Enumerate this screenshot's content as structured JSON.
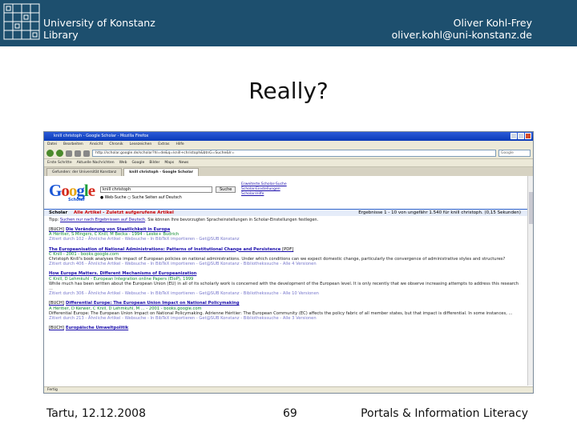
{
  "header": {
    "university_line1": "University of Konstanz",
    "university_line2": "Library",
    "author_name": "Oliver Kohl-Frey",
    "author_email": "oliver.kohl@uni-konstanz.de",
    "colors": {
      "band": "#1d4f6e",
      "text": "#ffffff"
    }
  },
  "slide": {
    "title": "Really?"
  },
  "browser": {
    "window_title": "knill christoph - Google Scholar - Mozilla Firefox",
    "menu": [
      "Datei",
      "Bearbeiten",
      "Ansicht",
      "Chronik",
      "Lesezeichen",
      "Extras",
      "Hilfe"
    ],
    "url": "http://scholar.google.de/scholar?hl=de&q=knill+christoph&btnG=Suche&lr=",
    "search_placeholder": "Google",
    "bookmarks": [
      "Erste Schritte",
      "Aktuelle Nachrichten",
      "Web",
      "Google",
      "Bilder",
      "Maps",
      "News"
    ],
    "tabs": [
      {
        "label": "Gefunden: der Universität Konstanz",
        "active": false
      },
      {
        "label": "knill christoph - Google Scholar",
        "active": true
      }
    ],
    "scholar": {
      "logo_sub": "Scholar",
      "query": "knill christoph",
      "search_button": "Suche",
      "options": "● Web-Suche  ○ Suche Seiten auf Deutsch",
      "links": [
        "Erweiterte Scholar-Suche",
        "Scholar-Einstellungen",
        "Scholar-Hilfe"
      ],
      "result_bar_label": "Scholar",
      "result_bar_filter": "Alle Artikel - Zuletzt aufgerufene Artikel",
      "result_count": "Ergebnisse 1 - 10 von ungefähr 1.540 für knill christoph. (0,15 Sekunden)",
      "tip_prefix": "Tipp:",
      "tip_link": "Suchen nur nach Ergebnissen auf Deutsch",
      "tip_rest": ". Sie können Ihre bevorzugten Spracheinstellungen in Scholar-Einstellungen festlegen."
    },
    "results": [
      {
        "tag": "[BUCH]",
        "title": "Die Veränderung von Staatlichkeit in Europa",
        "authors": "A Héritier, S Mingers, C Knill, M Becka - 1994 - Leske+ Budrich",
        "snippet": "",
        "links": "Zitiert durch 102 - Ähnliche Artikel - Websuche - In BibTeX importieren - Get@SUB Konstanz"
      },
      {
        "tag": "[PDF]",
        "title": "The Europeanisation of National Administrations: Patterns of Institutional Change and Persistence",
        "authors": "C Knill - 2001 - books.google.com",
        "snippet": "Christoph Knill's book analyses the impact of European policies on national administrations. Under which conditions can we expect domestic change, particularly the convergence of administrative styles and structures?",
        "links": "Zitiert durch 406 - Ähnliche Artikel - Websuche - In BibTeX importieren - Get@SUB Konstanz - Bibliothekssuche - Alle 4 Versionen"
      },
      {
        "tag": "",
        "title": "How Europe Matters. Different Mechanisms of Europeanization",
        "authors": "C Knill, D Lehmkuhl - European Integration online Papers (EIoP), 1999",
        "snippet": "While much has been written about the European Union (EU) in all of its scholarly work is concerned with the development of the European level. It is only recently that we observe increasing attempts to address this research ...",
        "links": "Zitiert durch 306 - Ähnliche Artikel - Websuche - In BibTeX importieren - Get@SUB Konstanz - Bibliothekssuche - Alle 10 Versionen"
      },
      {
        "tag": "[BUCH]",
        "title": "Differential Europe: The European Union Impact on National Policymaking",
        "authors": "A Héritier, D Kerwer, C Knill, D Lehmkuhl, M ... - 2001 - books.google.com",
        "snippet": "Differential Europe: The European Union Impact on National Policymaking. Adrienne Héritier: The European Community (EC) affects the policy fabric of all member states, but that impact is differential. In some instances, ...",
        "links": "Zitiert durch 213 - Ähnliche Artikel - Websuche - In BibTeX importieren - Get@SUB Konstanz - Bibliothekssuche - Alle 3 Versionen"
      },
      {
        "tag": "[BUCH]",
        "title": "Europäische Umweltpolitik",
        "authors": "",
        "snippet": "",
        "links": ""
      }
    ],
    "status": "Fertig"
  },
  "footer": {
    "date": "Tartu, 12.12.2008",
    "page": "69",
    "course": "Portals & Information Literacy"
  }
}
